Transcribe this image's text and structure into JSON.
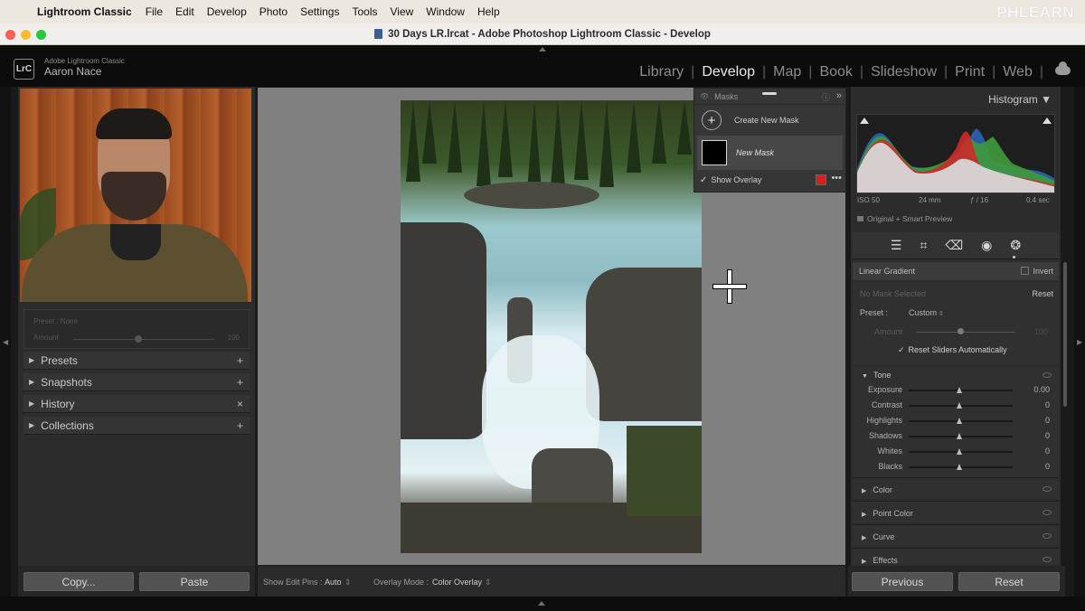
{
  "menubar": {
    "app": "Lightroom Classic",
    "items": [
      "File",
      "Edit",
      "Develop",
      "Photo",
      "Settings",
      "Tools",
      "View",
      "Window",
      "Help"
    ],
    "watermark": "PHLEARN"
  },
  "window": {
    "title": "30 Days LR.lrcat - Adobe Photoshop Lightroom Classic - Develop"
  },
  "identity": {
    "product": "Adobe Lightroom Classic",
    "user": "Aaron Nace",
    "badge": "LrC"
  },
  "modules": [
    "Library",
    "Develop",
    "Map",
    "Book",
    "Slideshow",
    "Print",
    "Web"
  ],
  "active_module": "Develop",
  "left_panel": {
    "preset_label": "Preset : None",
    "amount_label": "Amount",
    "amount_value": "100",
    "sections": [
      {
        "label": "Presets",
        "action": "+"
      },
      {
        "label": "Snapshots",
        "action": "+"
      },
      {
        "label": "History",
        "action": "×"
      },
      {
        "label": "Collections",
        "action": "+"
      }
    ],
    "copy_label": "Copy...",
    "paste_label": "Paste"
  },
  "masks_panel": {
    "title": "Masks",
    "create_label": "Create New Mask",
    "mask_name": "New Mask",
    "show_overlay_label": "Show Overlay",
    "overlay_color": "#d32020"
  },
  "toolbar": {
    "edit_pins_label": "Show Edit Pins :",
    "edit_pins_value": "Auto",
    "overlay_mode_label": "Overlay Mode :",
    "overlay_mode_value": "Color Overlay"
  },
  "histogram": {
    "title": "Histogram",
    "iso": "ISO 50",
    "focal": "24 mm",
    "aperture": "ƒ / 16",
    "shutter": "0.4 sec",
    "preview": "Original + Smart Preview"
  },
  "mask_settings": {
    "tool_name": "Linear Gradient",
    "invert_label": "Invert",
    "no_mask": "No Mask Selected",
    "reset_label": "Reset",
    "preset_label": "Preset :",
    "preset_value": "Custom",
    "amount_label": "Amount",
    "amount_value": "100",
    "reset_sliders_label": "Reset Sliders Automatically"
  },
  "tone": {
    "title": "Tone",
    "sliders": [
      {
        "label": "Exposure",
        "value": "0.00"
      },
      {
        "label": "Contrast",
        "value": "0"
      },
      {
        "label": "Highlights",
        "value": "0"
      },
      {
        "label": "Shadows",
        "value": "0"
      },
      {
        "label": "Whites",
        "value": "0"
      },
      {
        "label": "Blacks",
        "value": "0"
      }
    ]
  },
  "collapsed_sections": [
    "Color",
    "Point Color",
    "Curve",
    "Effects"
  ],
  "right_buttons": {
    "previous": "Previous",
    "reset": "Reset"
  }
}
